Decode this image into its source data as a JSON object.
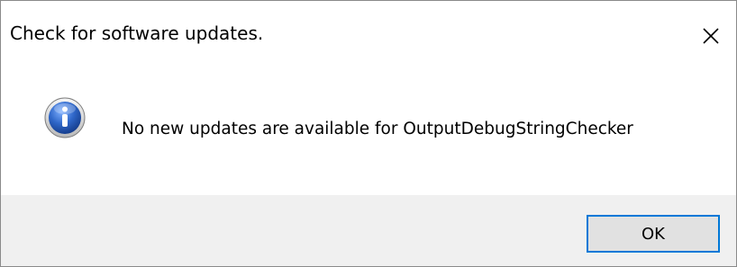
{
  "dialog": {
    "title": "Check for software updates.",
    "close_icon": "close-icon",
    "message_icon": "information-icon",
    "message": "No new updates are available for OutputDebugStringChecker",
    "ok_label": "OK"
  },
  "colors": {
    "footer_background": "#f0f0f0",
    "button_border_focus": "#0078d7",
    "icon_blue": "#2f67c9"
  }
}
